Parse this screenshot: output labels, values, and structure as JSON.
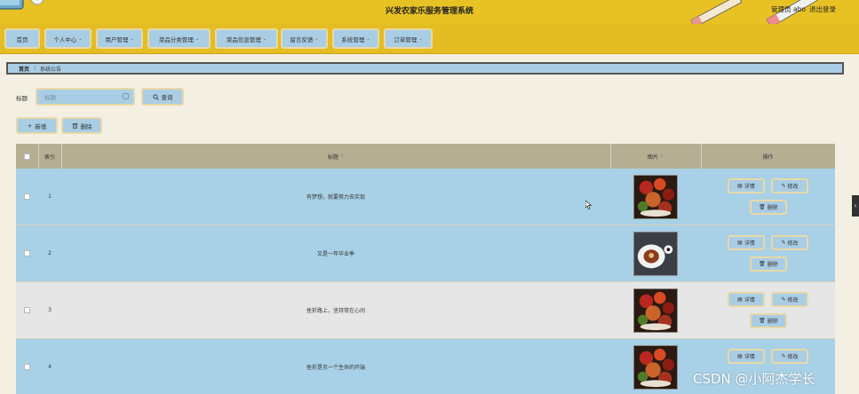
{
  "header": {
    "title": "兴发农家乐服务管理系统",
    "user": "管理员 abo",
    "logout": "退出登录"
  },
  "nav": {
    "items": [
      {
        "label": "首页",
        "dropdown": false
      },
      {
        "label": "个人中心",
        "dropdown": true
      },
      {
        "label": "用户管理",
        "dropdown": true
      },
      {
        "label": "菜品分类管理",
        "dropdown": true
      },
      {
        "label": "菜品信息管理",
        "dropdown": true
      },
      {
        "label": "留言反馈",
        "dropdown": true
      },
      {
        "label": "系统管理",
        "dropdown": true
      },
      {
        "label": "订单管理",
        "dropdown": true
      }
    ]
  },
  "breadcrumb": {
    "home": "首页",
    "separator": "/",
    "current": "系统公告"
  },
  "search": {
    "label": "标题",
    "placeholder": "标题",
    "button": "查询"
  },
  "toolbar": {
    "add": "新增",
    "delete": "删除"
  },
  "table": {
    "headers": {
      "index": "索引",
      "title": "标题",
      "image": "图片",
      "actions": "操作"
    },
    "rows": [
      {
        "index": "1",
        "title": "有梦想，就要努力去实现",
        "image": "food-platter"
      },
      {
        "index": "2",
        "title": "又是一年毕业季",
        "image": "dessert-plate"
      },
      {
        "index": "3",
        "title": "挫折路上，坚持常在心间",
        "image": "food-platter"
      },
      {
        "index": "4",
        "title": "挫折是另一个生命的开端",
        "image": "food-platter"
      }
    ],
    "actions": {
      "detail": "详情",
      "edit": "修改",
      "delete": "删除"
    }
  },
  "icons": {
    "sort": "⇕",
    "caret": "⌄",
    "side_tab": "‹"
  },
  "watermark": "CSDN @小阿杰学长",
  "colors": {
    "header_bg": "#e8c224",
    "button_bg": "#a9cde4",
    "button_border": "#e9d9a6",
    "table_head_bg": "#b5ae93",
    "row_blue": "#a8d0e6",
    "row_grey": "#e6e6e6",
    "page_bg": "#f3efe2"
  }
}
